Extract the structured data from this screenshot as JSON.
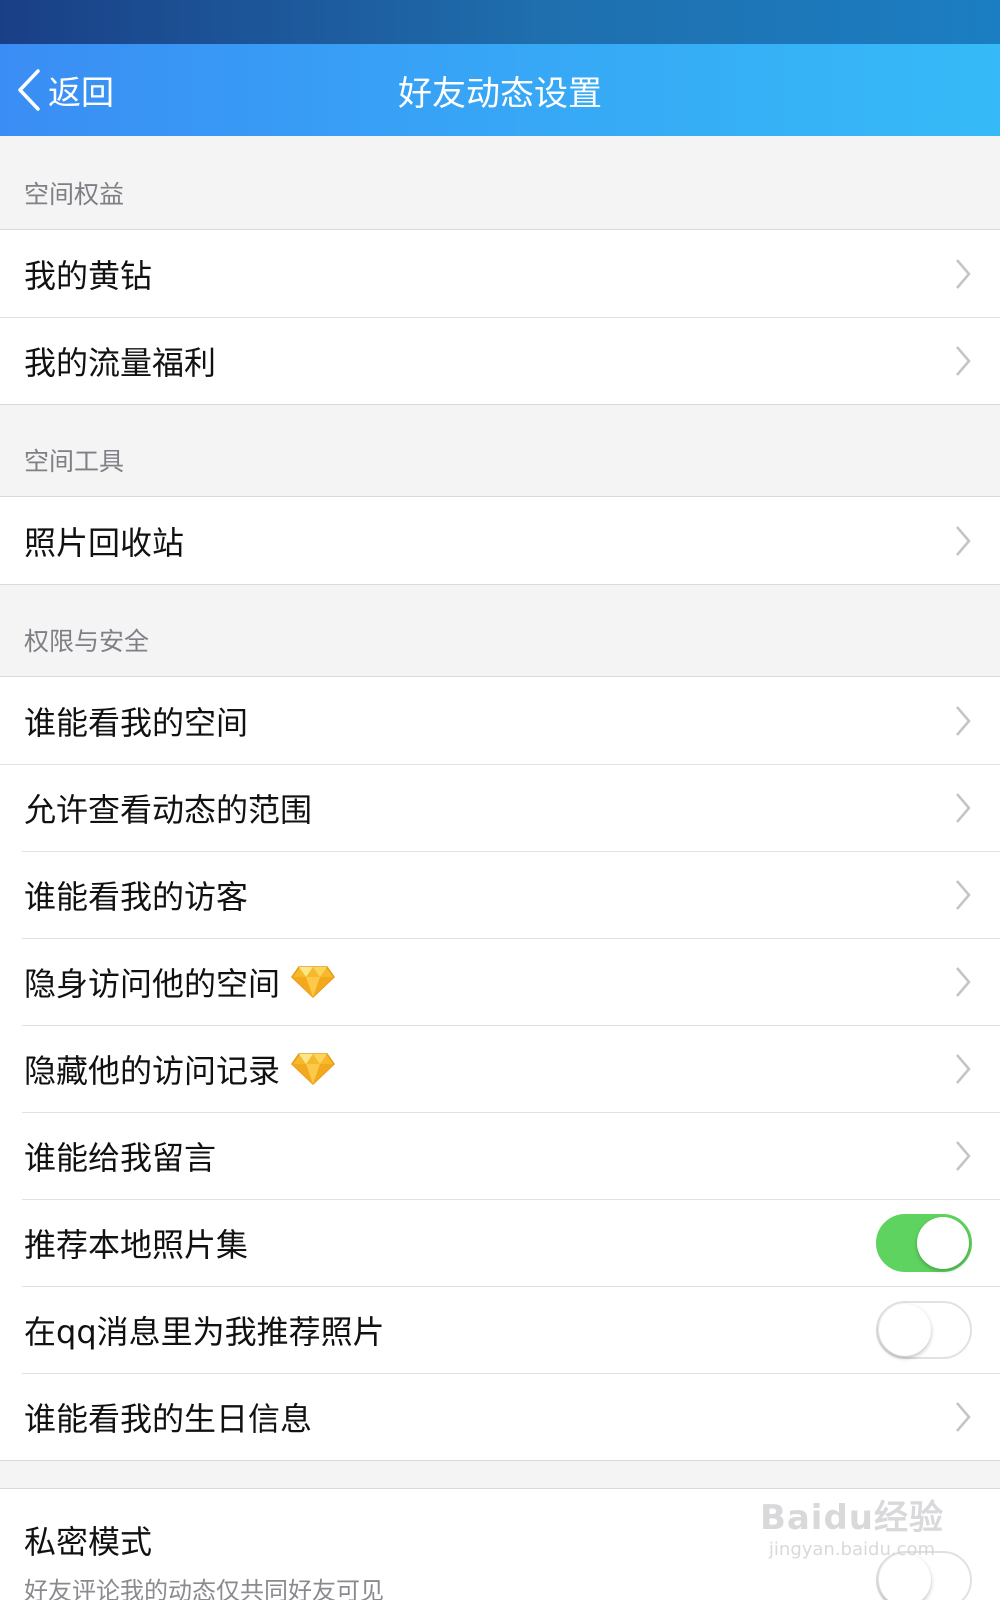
{
  "nav": {
    "back_label": "返回",
    "title": "好友动态设置"
  },
  "sections": {
    "benefits": {
      "header": "空间权益",
      "items": [
        "我的黄钻",
        "我的流量福利"
      ]
    },
    "tools": {
      "header": "空间工具",
      "items": [
        "照片回收站"
      ]
    },
    "security": {
      "header": "权限与安全",
      "items": [
        "谁能看我的空间",
        "允许查看动态的范围",
        "谁能看我的访客",
        "隐身访问他的空间",
        "隐藏他的访问记录",
        "谁能给我留言",
        "推荐本地照片集",
        "在qq消息里为我推荐照片",
        "谁能看我的生日信息"
      ],
      "toggles": {
        "recommend_local_albums": true,
        "qq_message_photo_recommend": false
      }
    },
    "private_mode": {
      "title": "私密模式",
      "description": "好友评论我的动态仅共同好友可见",
      "enabled": false
    }
  },
  "icons": {
    "back": "chevron-left-icon",
    "arrow": "chevron-right-icon",
    "vip": "yellow-diamond-icon"
  },
  "colors": {
    "nav_start": "#3a8df4",
    "nav_end": "#36baf7",
    "toggle_on": "#5fd35f",
    "diamond": "#f5b92c"
  },
  "watermark": {
    "logo": "Baidu经验",
    "url": "jingyan.baidu.com"
  }
}
